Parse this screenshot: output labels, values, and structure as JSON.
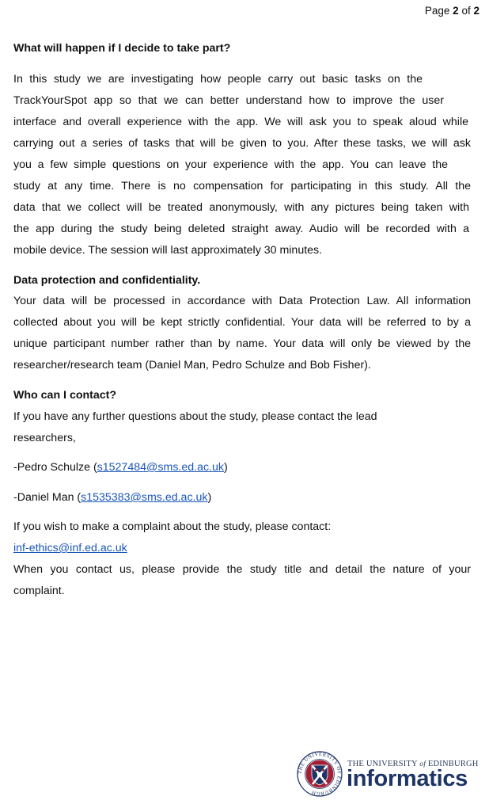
{
  "header": {
    "page_prefix": "Page",
    "page_current": "2",
    "page_sep": "of",
    "page_total": "2"
  },
  "section1": {
    "heading": "What will happen if I decide to take part?",
    "lines": [
      "In this study we are investigating how people carry out basic tasks on the",
      "TrackYourSpot app so that we can better understand how to improve the user",
      "interface and overall experience with the app. We will ask you to speak aloud while",
      "carrying out a series of tasks that will be given to you. After these tasks, we will ask",
      "you a few simple questions on your experience with the app. You can leave the",
      "study at any time. There is no compensation for participating in this study. All the",
      "data that we collect will be treated anonymously, with any pictures being taken with",
      "the app during the study being deleted straight away. Audio will be recorded with a",
      "mobile device. The session will last approximately 30 minutes."
    ]
  },
  "section2": {
    "heading": "Data protection and confidentiality.",
    "lines": [
      "Your data will be processed in accordance with Data Protection Law.  All information",
      "collected about you will be kept strictly confidential. Your data will be referred to by a",
      "unique participant number rather than by name. Your data will only be viewed by the",
      "researcher/research team (Daniel Man, Pedro Schulze and Bob Fisher)."
    ]
  },
  "section3": {
    "heading": "Who can I contact?",
    "intro_lines": [
      "If you have any further questions about the study, please contact the lead",
      "researchers,"
    ],
    "contacts": [
      {
        "prefix": "-Pedro Schulze (",
        "email": "s1527484@sms.ed.ac.uk",
        "suffix": ")"
      },
      {
        "prefix": "-Daniel Man (",
        "email": "s1535383@sms.ed.ac.uk",
        "suffix": ")"
      }
    ],
    "complaint_line": "If you wish to make a complaint about the study, please contact:",
    "complaint_email": "inf-ethics@inf.ed.ac.uk",
    "final_lines": [
      "When you contact us, please provide the study title and detail the nature of your",
      "complaint."
    ]
  },
  "footer": {
    "uni_name_pre": "THE UNIVERSITY",
    "uni_name_of": "of",
    "uni_name_post": "EDINBURGH",
    "brand": "informatics",
    "crest_ring_text": "THE UNIVERSITY OF EDINBURGH",
    "colors": {
      "navy": "#1d3466",
      "red": "#a41f35"
    }
  }
}
